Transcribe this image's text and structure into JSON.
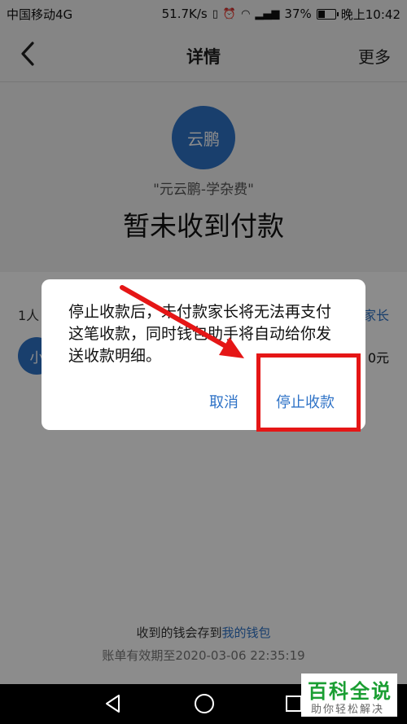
{
  "status_bar": {
    "carrier": "中国移动4G",
    "speed": "51.7K/s",
    "battery_percent": "37%",
    "time": "晚上10:42"
  },
  "nav": {
    "title": "详情",
    "more_label": "更多"
  },
  "payment": {
    "avatar_text": "云鹏",
    "name": "\"元云鹏-学杂费\"",
    "status": "暂未收到付款"
  },
  "list": {
    "count_text": "1人",
    "remind_text": "家长",
    "row_avatar_text": "小",
    "row_amount": "0元"
  },
  "footer": {
    "line1_prefix": "收到的钱会存到",
    "line1_link": "我的钱包",
    "line2": "账单有效期至2020-03-06 22:35:19"
  },
  "dialog": {
    "message": "停止收款后，未付款家长将无法再支付这笔收款，同时钱包助手将自动给你发送收款明细。",
    "cancel_label": "取消",
    "confirm_label": "停止收款"
  },
  "watermark": {
    "title": "百科全说",
    "subtitle": "助你轻松解决"
  },
  "colors": {
    "accent": "#2f73c7",
    "highlight": "#e51616",
    "watermark_green": "#1a9e32"
  }
}
